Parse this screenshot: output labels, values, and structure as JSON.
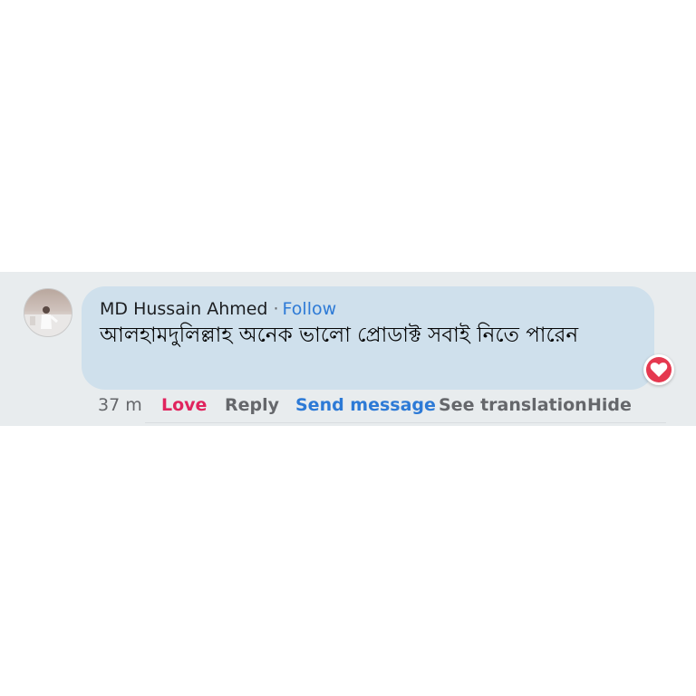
{
  "comment": {
    "author": "MD Hussain Ahmed",
    "separator": "·",
    "follow_label": "Follow",
    "text": "আলহামদুলিল্লাহ অনেক ভালো প্রোডাক্ট সবাই নিতে পারেন",
    "reaction_icon": "heart-icon"
  },
  "actions": {
    "time": "37 m",
    "love": "Love",
    "reply": "Reply",
    "send_message": "Send message",
    "see_translation": "See translation",
    "hide": "Hide"
  },
  "colors": {
    "bubble": "#cfe0ec",
    "strip": "#e8ecee",
    "link_blue": "#2d7ad6",
    "love_red": "#e0245e"
  }
}
